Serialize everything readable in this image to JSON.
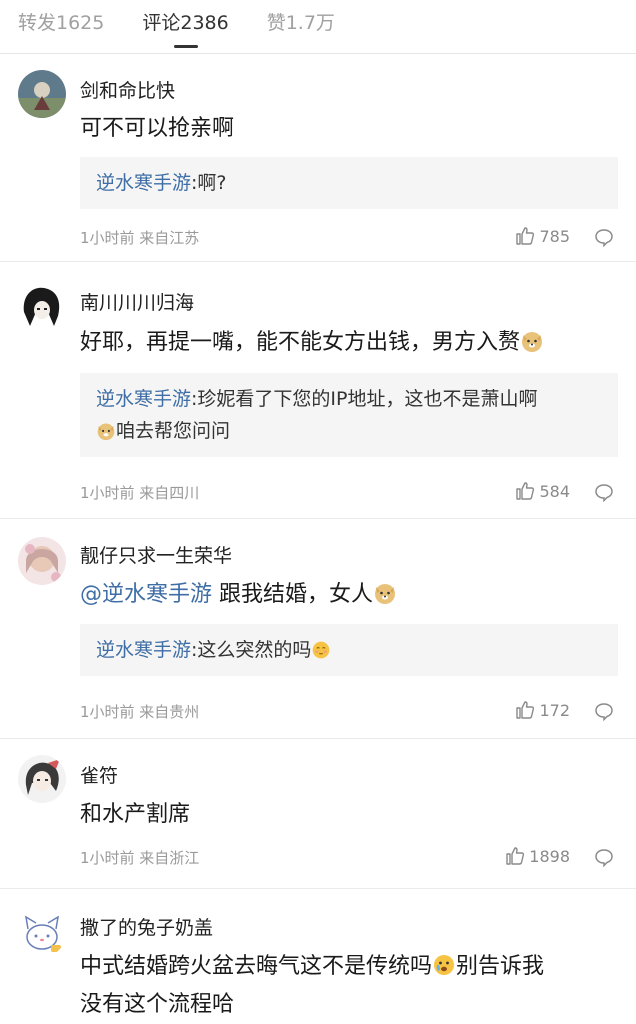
{
  "tabs": [
    {
      "label": "转发1625"
    },
    {
      "label": "评论2386"
    },
    {
      "label": "赞1.7万"
    }
  ],
  "comments": [
    {
      "username": "剑和命比快",
      "text": "可不可以抢亲啊",
      "reply_name": "逆水寒手游",
      "reply_text": ":啊?",
      "meta": "1小时前 来自江苏",
      "likes": "785"
    },
    {
      "username": "南川川川归海",
      "text": "好耶，再提一嘴，能不能女方出钱，男方入赘",
      "reply_name": "逆水寒手游",
      "reply_text": ":珍妮看了下您的IP地址，这也不是萧山啊",
      "reply_text2": "咱去帮您问问",
      "meta": "1小时前 来自四川",
      "likes": "584"
    },
    {
      "username": "靓仔只求一生荣华",
      "mention": "@逆水寒手游",
      "text": " 跟我结婚，女人",
      "reply_name": "逆水寒手游",
      "reply_text": ":这么突然的吗",
      "meta": "1小时前 来自贵州",
      "likes": "172"
    },
    {
      "username": "雀符",
      "text": "和水产割席",
      "meta": "1小时前 来自浙江",
      "likes": "1898"
    },
    {
      "username": "撒了的兔子奶盖",
      "text": "中式结婚跨火盆去晦气这不是传统吗",
      "text_b": "别告诉我",
      "text2": "没有这个流程哈"
    }
  ],
  "icons": {
    "like": "thumbs-up-icon",
    "reply": "chat-bubble-icon"
  },
  "colors": {
    "link": "#3f6ea6",
    "reply_bg": "#f5f5f5",
    "meta": "#9a9a9a"
  }
}
